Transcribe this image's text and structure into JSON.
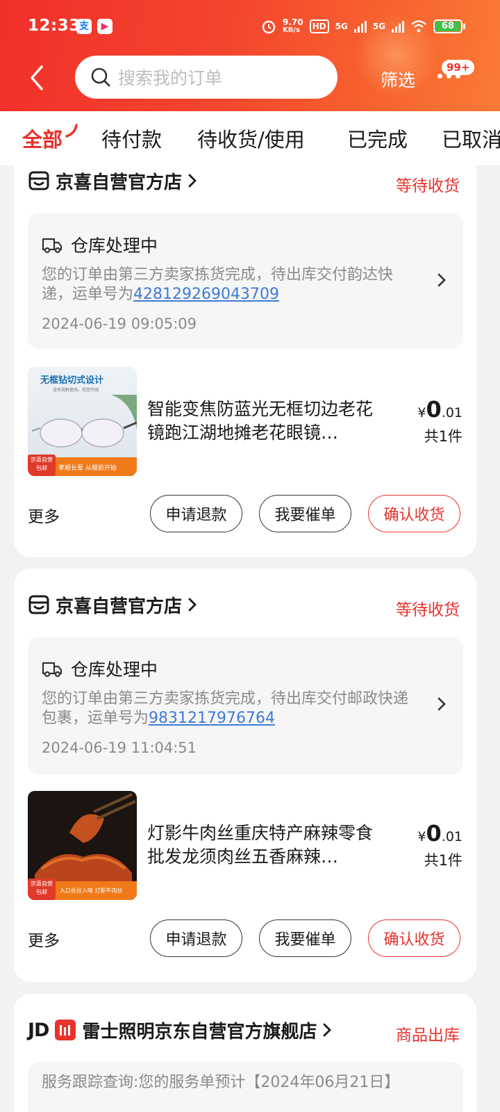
{
  "status_bar": {
    "time": "12:33",
    "speed_value": "9.70",
    "speed_unit": "KB/s",
    "hd": "HD",
    "network_1": "5G",
    "network_2": "5G",
    "battery": "68"
  },
  "header": {
    "search_placeholder": "搜索我的订单",
    "filter_label": "筛选",
    "badge": "99+"
  },
  "tabs": [
    {
      "label": "全部",
      "active": true
    },
    {
      "label": "待付款"
    },
    {
      "label": "待收货/使用"
    },
    {
      "label": "已完成"
    },
    {
      "label": "已取消"
    }
  ],
  "orders": [
    {
      "shop": "京喜自营官方店",
      "status": "等待收货",
      "logistics_title": "仓库处理中",
      "logistics_desc_1": "您的订单由第三方卖家拣货完成，待出库交付韵达快递，运单号为",
      "tracking_no": "428129269043709",
      "logistics_time": "2024-06-19 09:05:09",
      "product_title": "智能变焦防蓝光无框切边老花镜跑江湖地摊老花眼镜…",
      "image_caption_top": "无框钻切式设计",
      "image_caption_sub": "没有视野遮挡，视觉开阔",
      "image_tag": "京喜自营 包邮",
      "image_caption_bottom": "孝顺长辈 从眼前开始",
      "price_symbol": "¥",
      "price_int": "0",
      "price_dec": ".01",
      "qty": "共1件",
      "more": "更多",
      "btn_refund": "申请退款",
      "btn_urge": "我要催单",
      "btn_confirm": "确认收货"
    },
    {
      "shop": "京喜自营官方店",
      "status": "等待收货",
      "logistics_title": "仓库处理中",
      "logistics_desc_1": "您的订单由第三方卖家拣货完成，待出库交付邮政快递包裹，运单号为",
      "tracking_no": "9831217976764",
      "logistics_time": "2024-06-19 11:04:51",
      "product_title": "灯影牛肉丝重庆特产麻辣零食批发龙须肉丝五香麻辣…",
      "image_tag": "京喜自营 包邮",
      "image_caption_bottom": "入口丝丝入味 灯影牛肉丝",
      "price_symbol": "¥",
      "price_int": "0",
      "price_dec": ".01",
      "qty": "共1件",
      "more": "更多",
      "btn_refund": "申请退款",
      "btn_urge": "我要催单",
      "btn_confirm": "确认收货"
    },
    {
      "shop_logo": "JD",
      "shop": "雷士照明京东自营官方旗舰店",
      "status": "商品出库",
      "logistics_desc_1": "服务跟踪查询:您的服务单预计【2024年06月21日】"
    }
  ],
  "colors": {
    "accent": "#e8322c",
    "link": "#3f7ad8",
    "header_gradient_start": "#f0302a",
    "header_gradient_end": "#fa7a35"
  }
}
